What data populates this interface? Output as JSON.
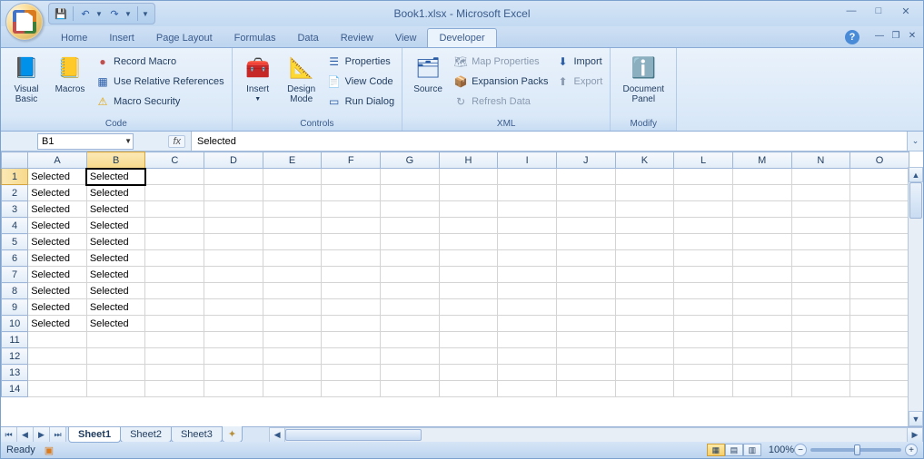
{
  "title": "Book1.xlsx - Microsoft Excel",
  "qat": {
    "save": "💾",
    "undo": "↶",
    "redo": "↷"
  },
  "tabs": [
    "Home",
    "Insert",
    "Page Layout",
    "Formulas",
    "Data",
    "Review",
    "View",
    "Developer"
  ],
  "activeTab": "Developer",
  "ribbon": {
    "code": {
      "label": "Code",
      "visualBasic": "Visual Basic",
      "macros": "Macros",
      "recordMacro": "Record Macro",
      "useRelRefs": "Use Relative References",
      "macroSecurity": "Macro Security"
    },
    "controls": {
      "label": "Controls",
      "insert": "Insert",
      "designMode": "Design Mode",
      "properties": "Properties",
      "viewCode": "View Code",
      "runDialog": "Run Dialog"
    },
    "xml": {
      "label": "XML",
      "source": "Source",
      "mapProps": "Map Properties",
      "expansion": "Expansion Packs",
      "refresh": "Refresh Data",
      "import": "Import",
      "export": "Export"
    },
    "modify": {
      "label": "Modify",
      "docPanel": "Document Panel"
    }
  },
  "nameBox": "B1",
  "formula": "Selected",
  "columns": [
    "A",
    "B",
    "C",
    "D",
    "E",
    "F",
    "G",
    "H",
    "I",
    "J",
    "K",
    "L",
    "M",
    "N",
    "O"
  ],
  "rowCount": 14,
  "activeCell": {
    "row": 1,
    "col": "B"
  },
  "cells": {
    "A1": "Selected",
    "B1": "Selected",
    "A2": "Selected",
    "B2": "Selected",
    "A3": "Selected",
    "B3": "Selected",
    "A4": "Selected",
    "B4": "Selected",
    "A5": "Selected",
    "B5": "Selected",
    "A6": "Selected",
    "B6": "Selected",
    "A7": "Selected",
    "B7": "Selected",
    "A8": "Selected",
    "B8": "Selected",
    "A9": "Selected",
    "B9": "Selected",
    "A10": "Selected",
    "B10": "Selected"
  },
  "sheets": [
    "Sheet1",
    "Sheet2",
    "Sheet3"
  ],
  "activeSheet": "Sheet1",
  "status": "Ready",
  "zoom": "100%"
}
